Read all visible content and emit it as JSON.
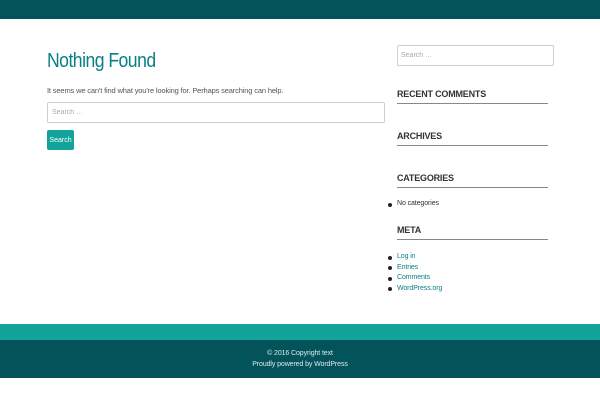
{
  "main": {
    "title": "Nothing Found",
    "description": "It seems we can't find what you're looking for. Perhaps searching can help.",
    "search": {
      "placeholder": "Search …",
      "button_label": "Search"
    }
  },
  "sidebar": {
    "search": {
      "placeholder": "Search …"
    },
    "recent_comments": {
      "title": "RECENT COMMENTS"
    },
    "archives": {
      "title": "ARCHIVES"
    },
    "categories": {
      "title": "CATEGORIES",
      "items": [
        "No categories"
      ]
    },
    "meta": {
      "title": "META",
      "items": [
        "Log in",
        "Entries",
        "Comments",
        "WordPress.org"
      ]
    }
  },
  "footer": {
    "copyright": "© 2016 Copyright text",
    "powered": "Proudly powered by WordPress"
  },
  "colors": {
    "header_bar": "#03545a",
    "accent": "#12a39b",
    "title_color": "#0a7f86",
    "footer_bg": "#03545a"
  }
}
